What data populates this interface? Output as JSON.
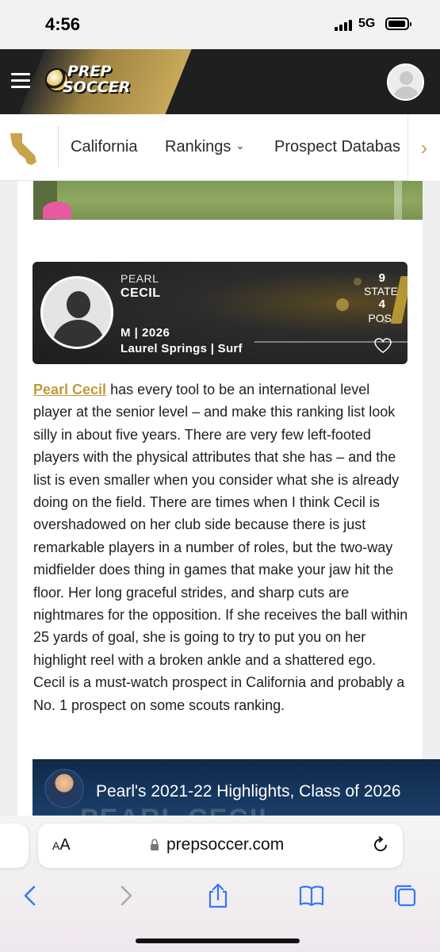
{
  "status_bar": {
    "time": "4:56",
    "network": "5G"
  },
  "header": {
    "logo_line1": "PREP",
    "logo_line2": "SOCCER"
  },
  "nav": {
    "items": [
      {
        "label": "California"
      },
      {
        "label": "Rankings"
      },
      {
        "label": "Prospect Databas"
      }
    ]
  },
  "player": {
    "first_name": "PEARL",
    "last_name": "CECIL",
    "meta": "M | 2026",
    "club": "Laurel Springs | Surf",
    "state_rank": "9",
    "state_label": "STATE",
    "pos_rank": "4",
    "pos_label": "POS"
  },
  "article": {
    "link_text": "Pearl Cecil",
    "body": " has every tool to be an international level player at the senior level – and make this ranking list look silly in about five years. There are very few left-footed players with the physical attributes that she has – and the list is even smaller when you consider what she is already doing on the field. There are times when I think Cecil is overshadowed on her club side because there is just remarkable players in a number of roles, but the two-way midfielder does thing in games that make your jaw hit the floor. Her long graceful strides, and sharp cuts are nightmares for the opposition. If she receives the ball within 25 yards of goal, she is going to try to put you on her highlight reel with a broken ankle and a shattered ego. Cecil is a must-watch prospect in California and probably a No. 1 prospect on some scouts ranking."
  },
  "video": {
    "title": "Pearl's 2021-22 Highlights, Class of 2026",
    "bg_text": "PEARL CECIL"
  },
  "browser": {
    "aa_label": "AA",
    "url": "prepsoccer.com"
  },
  "colors": {
    "gold": "#c8a34a",
    "header_bg": "#1f1f1f",
    "link": "#c19a3a",
    "ios_blue": "#3478f6"
  }
}
